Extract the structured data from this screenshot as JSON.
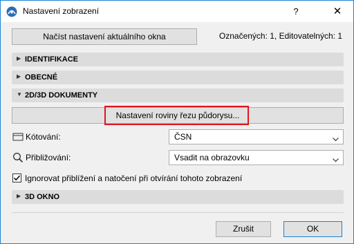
{
  "window": {
    "title": "Nastavení zobrazení",
    "help_label": "?",
    "close_label": "✕"
  },
  "toolbar": {
    "load_button_label": "Načíst nastavení aktuálního okna",
    "status_text": "Označených: 1, Editovatelných: 1"
  },
  "sections": {
    "identification": "IDENTIFIKACE",
    "general": "OBECNÉ",
    "docs_2d3d": "2D/3D DOKUMENTY",
    "window_3d": "3D OKNO"
  },
  "docs": {
    "cut_plane_button_label": "Nastavení roviny řezu půdorysu...",
    "dimensioning_label": "Kótování:",
    "dimensioning_value": "ČSN",
    "zoom_label": "Přibližování:",
    "zoom_value": "Vsadit na obrazovku",
    "ignore_zoom_label": "Ignorovat přiblížení a natočení při otvírání tohoto zobrazení",
    "ignore_zoom_checked": true
  },
  "footer": {
    "cancel_label": "Zrušit",
    "ok_label": "OK"
  },
  "colors": {
    "accent": "#1883d7",
    "highlight": "#e0141e",
    "section_bg": "#dcdcdc"
  },
  "icons": {
    "app": "archicad-icon",
    "expand": "triangle-right-icon",
    "collapse": "triangle-down-icon",
    "dimension": "dimension-icon",
    "zoom": "magnifier-icon",
    "dropdown": "chevron-down-icon",
    "check": "checkmark-icon"
  }
}
